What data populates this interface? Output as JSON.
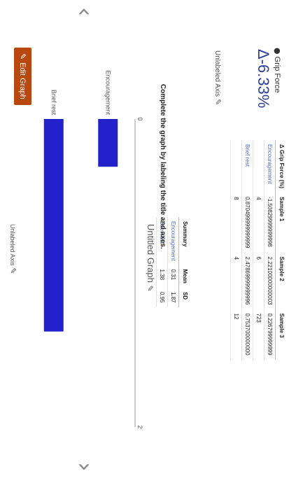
{
  "nav": {
    "prev_icon": "chevron-left-icon",
    "next_icon": "chevron-right-icon"
  },
  "stat": {
    "label": "Grip Force",
    "value": "Δ-6.33%"
  },
  "edit_graph_label": "Edit Graph",
  "table1": {
    "headers": [
      "Δ Grip Force (%)",
      "Sample 1",
      "Sample 2",
      "Sample 3"
    ],
    "rows": [
      [
        "Encouragement",
        "-1.50829999999998",
        "2.22100000000003",
        "0.226799999999"
      ],
      [
        "",
        "4",
        "6",
        "723"
      ],
      [
        "Brief rest",
        "0.870499999999999",
        "2.47869999999996",
        "0.753700000000"
      ],
      [
        "",
        "8",
        "4",
        "12"
      ]
    ]
  },
  "table2": {
    "headers": [
      "Summary",
      "Mean",
      "SD"
    ],
    "rows": [
      [
        "Encouragement",
        "0.31",
        "1.87"
      ],
      [
        "Brief rest",
        "1.38",
        "0.95"
      ]
    ]
  },
  "instruction": "Complete the graph by labeling the title and axes.",
  "chart_data": {
    "type": "bar",
    "title": "Untitled Graph",
    "xlabel": "Unlabeled Axis",
    "ylabel": "Unlabeled Axis",
    "categories": [
      "Encouragement",
      "Brief rest"
    ],
    "values": [
      0.31,
      1.38
    ],
    "ylim": [
      0,
      2
    ],
    "yticks": [
      "0",
      "2"
    ],
    "bar_color": "#2222cc"
  }
}
